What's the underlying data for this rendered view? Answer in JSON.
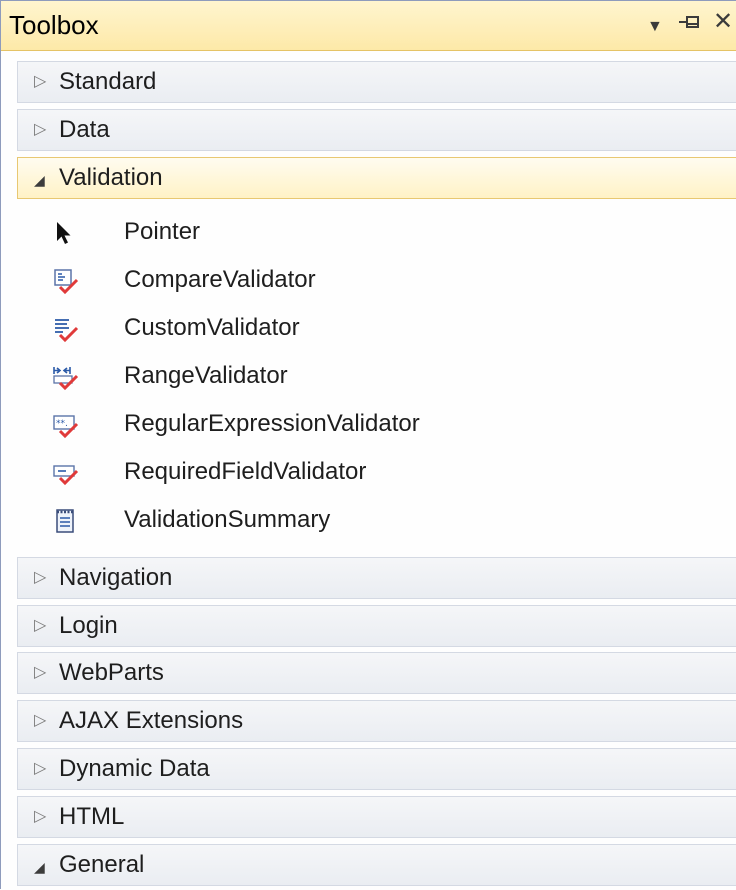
{
  "toolbox": {
    "title": "Toolbox",
    "dropdown_icon": "dropdown-icon",
    "pin_icon": "pin-icon",
    "close_icon": "close-icon"
  },
  "categories": [
    {
      "label": "Standard",
      "expanded": false
    },
    {
      "label": "Data",
      "expanded": false
    },
    {
      "label": "Validation",
      "expanded": true
    },
    {
      "label": "Navigation",
      "expanded": false
    },
    {
      "label": "Login",
      "expanded": false
    },
    {
      "label": "WebParts",
      "expanded": false
    },
    {
      "label": "AJAX Extensions",
      "expanded": false
    },
    {
      "label": "Dynamic Data",
      "expanded": false
    },
    {
      "label": "HTML",
      "expanded": false
    },
    {
      "label": "General",
      "expanded": true
    }
  ],
  "validation_items": [
    {
      "label": "Pointer",
      "icon": "pointer-icon"
    },
    {
      "label": "CompareValidator",
      "icon": "compare-validator-icon"
    },
    {
      "label": "CustomValidator",
      "icon": "custom-validator-icon"
    },
    {
      "label": "RangeValidator",
      "icon": "range-validator-icon"
    },
    {
      "label": "RegularExpressionValidator",
      "icon": "regex-validator-icon"
    },
    {
      "label": "RequiredFieldValidator",
      "icon": "required-field-validator-icon"
    },
    {
      "label": "ValidationSummary",
      "icon": "validation-summary-icon"
    }
  ],
  "colors": {
    "title_bar": "#fde9a8",
    "selected_category": "#fff2c6",
    "category": "#eaedf2",
    "check_red": "#e03a3a",
    "icon_blue": "#2b5aa8"
  }
}
